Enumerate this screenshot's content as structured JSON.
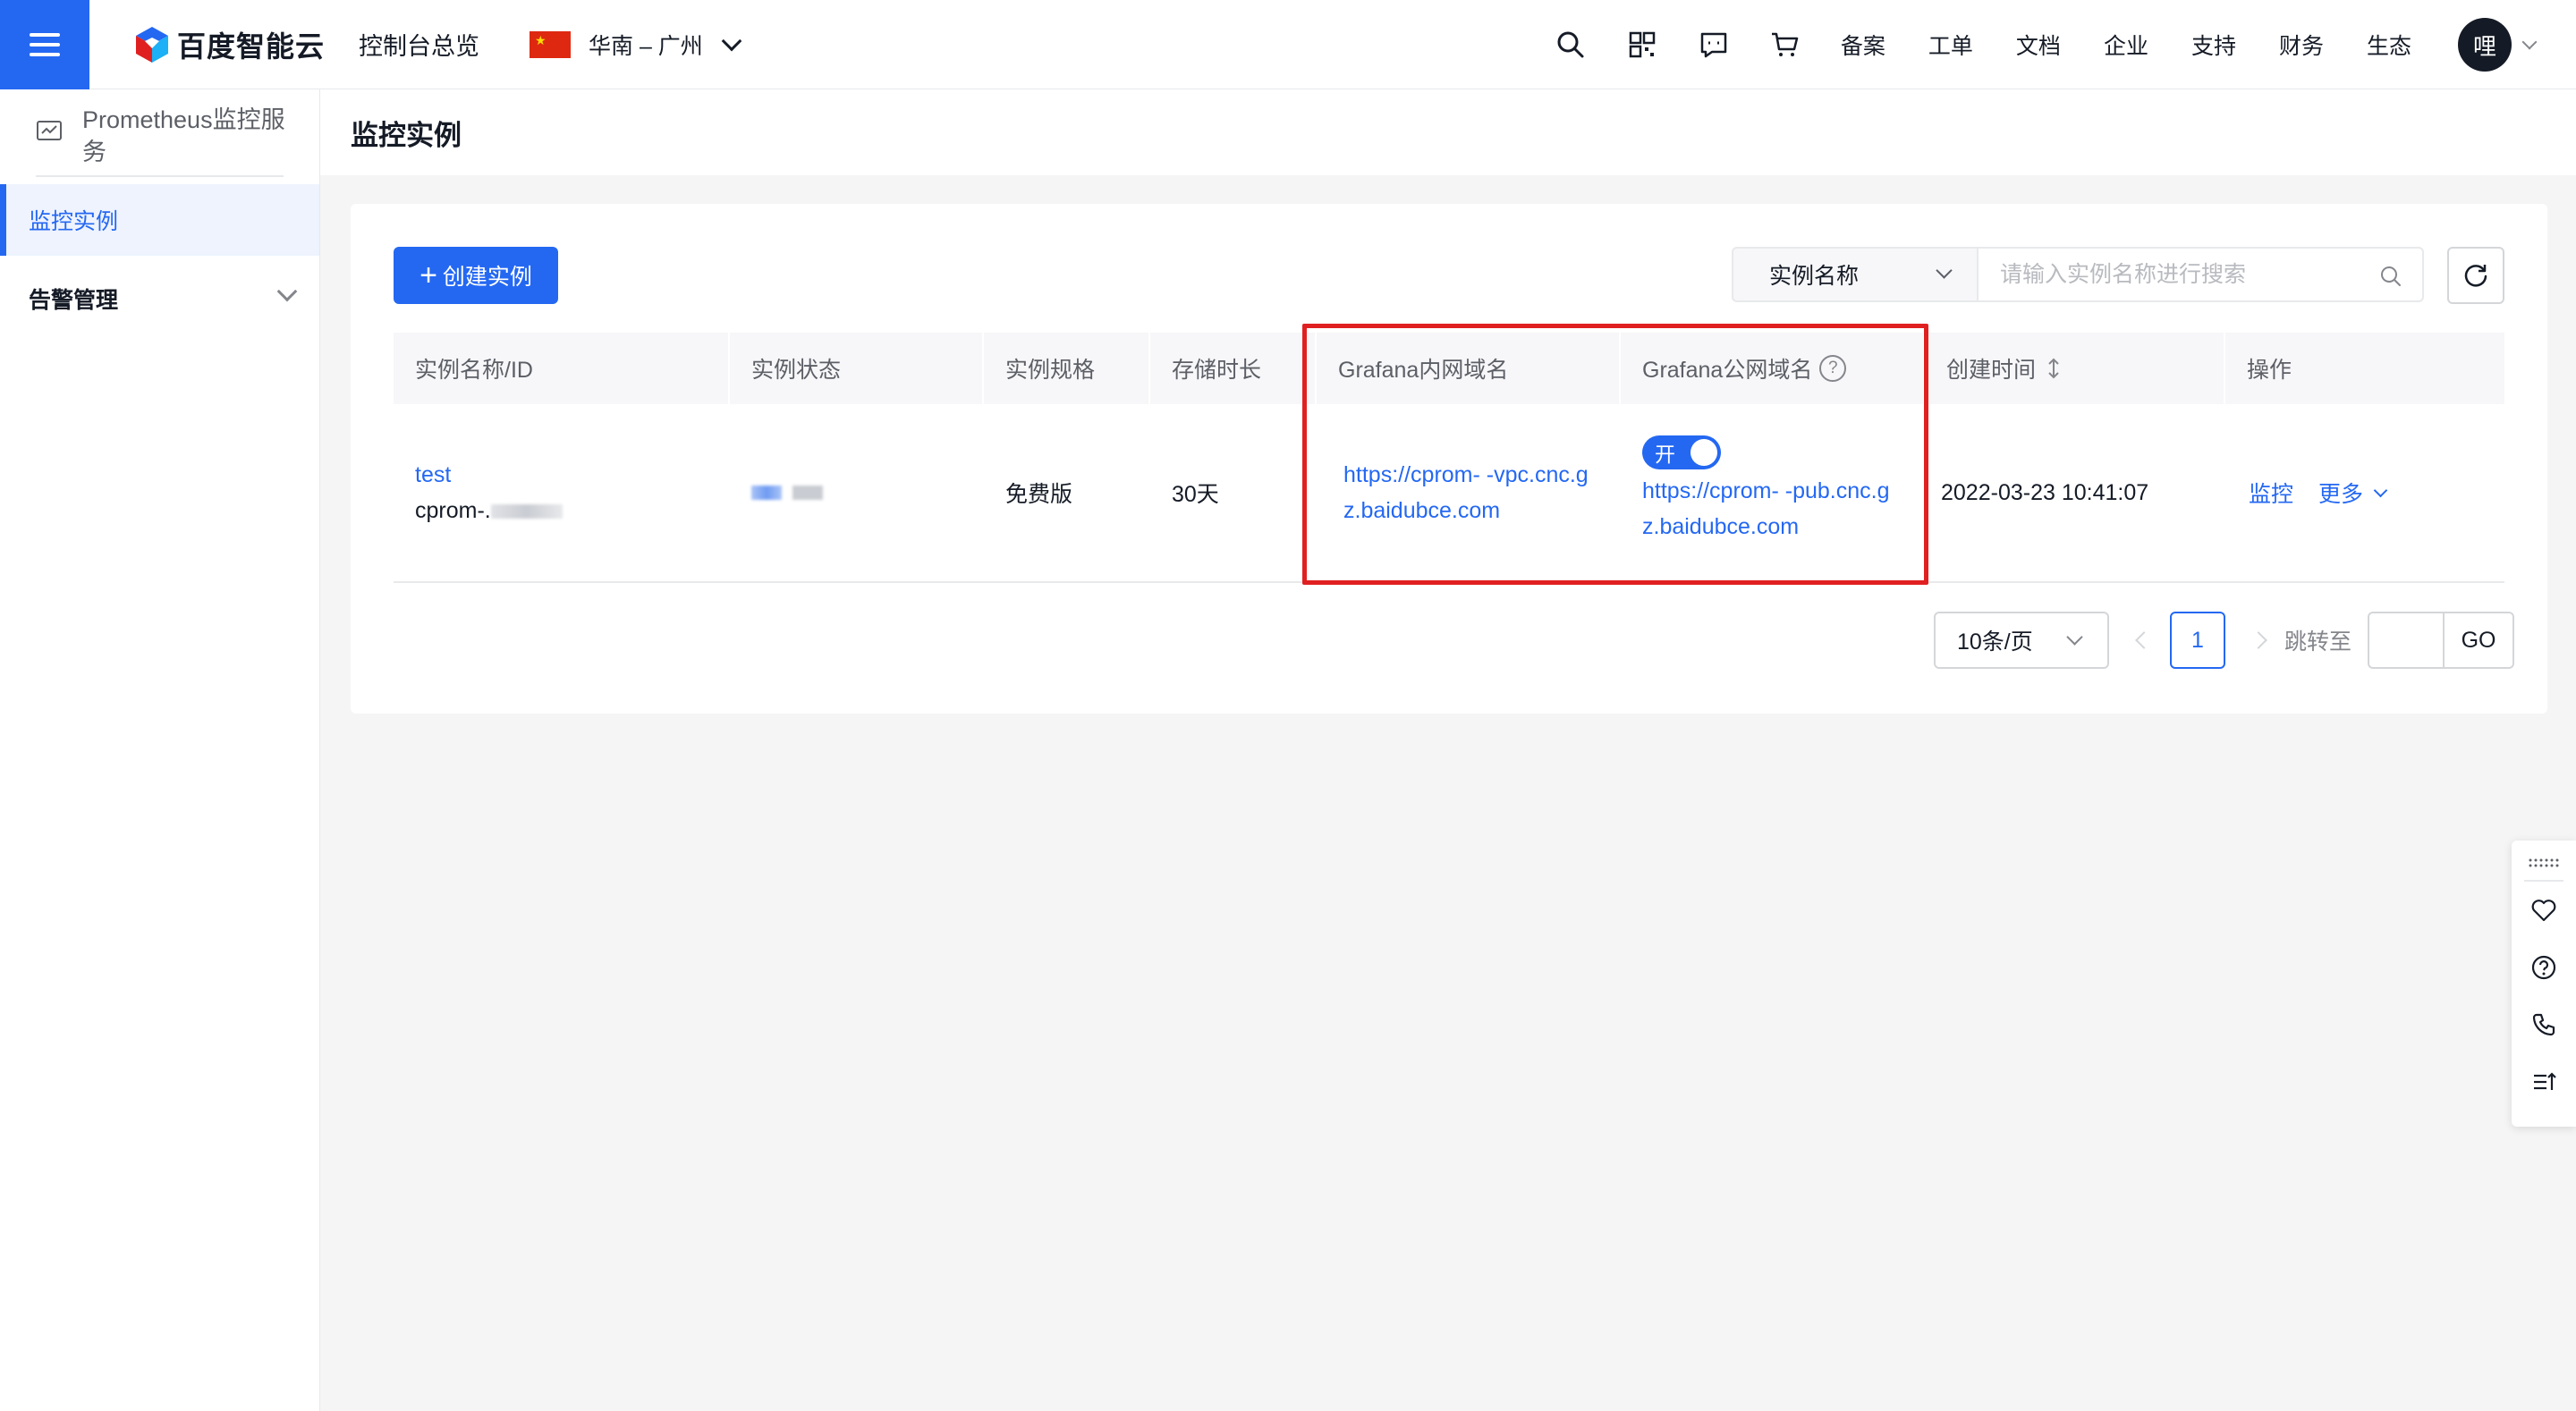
{
  "topbar": {
    "logo_text": "百度智能云",
    "console_title": "控制台总览",
    "region": "华南 – 广州",
    "icons": [
      "search-icon",
      "qrcode-icon",
      "message-icon",
      "cart-icon"
    ],
    "links": [
      "备案",
      "工单",
      "文档",
      "企业",
      "支持",
      "财务",
      "生态"
    ],
    "avatar_text": "哩"
  },
  "sidebar": {
    "service_title": "Prometheus监控服务",
    "items": [
      {
        "label": "监控实例",
        "active": true
      },
      {
        "label": "告警管理",
        "active": false,
        "expandable": true
      }
    ]
  },
  "main": {
    "page_title": "监控实例",
    "create_button": "创建实例",
    "search": {
      "field_select": "实例名称",
      "placeholder": "请输入实例名称进行搜索"
    },
    "table": {
      "columns": [
        "实例名称/ID",
        "实例状态",
        "实例规格",
        "存储时长",
        "Grafana内网域名",
        "Grafana公网域名",
        "创建时间",
        "操作"
      ],
      "rows": [
        {
          "name": "test",
          "id": "cprom-.",
          "spec": "免费版",
          "retention": "30天",
          "grafana_internal": "https://cprom-  -vpc.cnc.gz.baidubce.com",
          "grafana_public_toggle": "开",
          "grafana_public": "https://cprom-  -pub.cnc.gz.baidubce.com",
          "created": "2022-03-23 10:41:07",
          "actions": {
            "monitor": "监控",
            "more": "更多"
          }
        }
      ]
    },
    "pagination": {
      "page_size": "10条/页",
      "current_page": "1",
      "jump_label": "跳转至",
      "go_label": "GO"
    }
  },
  "colors": {
    "primary": "#2468f2",
    "highlight_border": "#e02020",
    "text": "#151b26"
  }
}
